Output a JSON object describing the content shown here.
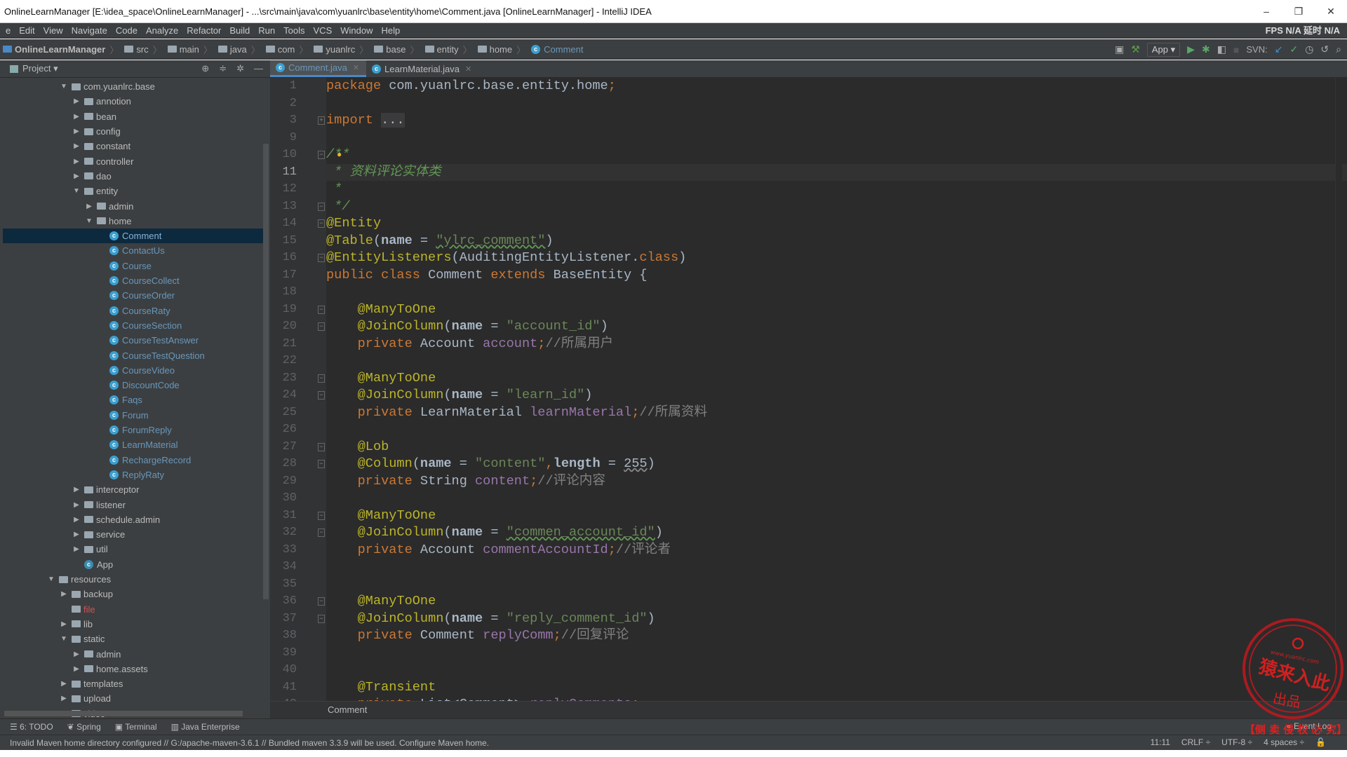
{
  "window": {
    "title": "OnlineLearnManager [E:\\idea_space\\OnlineLearnManager] - ...\\src\\main\\java\\com\\yuanlrc\\base\\entity\\home\\Comment.java [OnlineLearnManager] - IntelliJ IDEA",
    "controls": [
      "–",
      "❐",
      "✕"
    ]
  },
  "menu": [
    "e",
    "Edit",
    "View",
    "Navigate",
    "Code",
    "Analyze",
    "Refactor",
    "Build",
    "Run",
    "Tools",
    "VCS",
    "Window",
    "Help"
  ],
  "fps": "FPS N/A 延时 N/A",
  "breadcrumbs": [
    "OnlineLearnManager",
    "src",
    "main",
    "java",
    "com",
    "yuanlrc",
    "base",
    "entity",
    "home",
    "Comment"
  ],
  "toolbar": {
    "run_config": "App ▾",
    "svn_label": "SVN:"
  },
  "project_panel": {
    "title": "Project ▾"
  },
  "tree": [
    {
      "label": "com.yuanlrc.base",
      "depth": 0,
      "arrow": "down",
      "type": "folder"
    },
    {
      "label": "annotion",
      "depth": 1,
      "arrow": "right",
      "type": "folder"
    },
    {
      "label": "bean",
      "depth": 1,
      "arrow": "right",
      "type": "folder"
    },
    {
      "label": "config",
      "depth": 1,
      "arrow": "right",
      "type": "folder"
    },
    {
      "label": "constant",
      "depth": 1,
      "arrow": "right",
      "type": "folder"
    },
    {
      "label": "controller",
      "depth": 1,
      "arrow": "right",
      "type": "folder"
    },
    {
      "label": "dao",
      "depth": 1,
      "arrow": "right",
      "type": "folder"
    },
    {
      "label": "entity",
      "depth": 1,
      "arrow": "down",
      "type": "folder"
    },
    {
      "label": "admin",
      "depth": 2,
      "arrow": "right",
      "type": "folder"
    },
    {
      "label": "home",
      "depth": 2,
      "arrow": "down",
      "type": "folder"
    },
    {
      "label": "Comment",
      "depth": 3,
      "type": "class",
      "selected": true
    },
    {
      "label": "ContactUs",
      "depth": 3,
      "type": "class"
    },
    {
      "label": "Course",
      "depth": 3,
      "type": "class"
    },
    {
      "label": "CourseCollect",
      "depth": 3,
      "type": "class"
    },
    {
      "label": "CourseOrder",
      "depth": 3,
      "type": "class"
    },
    {
      "label": "CourseRaty",
      "depth": 3,
      "type": "class"
    },
    {
      "label": "CourseSection",
      "depth": 3,
      "type": "class"
    },
    {
      "label": "CourseTestAnswer",
      "depth": 3,
      "type": "class"
    },
    {
      "label": "CourseTestQuestion",
      "depth": 3,
      "type": "class"
    },
    {
      "label": "CourseVideo",
      "depth": 3,
      "type": "class"
    },
    {
      "label": "DiscountCode",
      "depth": 3,
      "type": "class"
    },
    {
      "label": "Faqs",
      "depth": 3,
      "type": "class"
    },
    {
      "label": "Forum",
      "depth": 3,
      "type": "class",
      "status": "red"
    },
    {
      "label": "ForumReply",
      "depth": 3,
      "type": "class",
      "status": "red"
    },
    {
      "label": "LearnMaterial",
      "depth": 3,
      "type": "class"
    },
    {
      "label": "RechargeRecord",
      "depth": 3,
      "type": "class"
    },
    {
      "label": "ReplyRaty",
      "depth": 3,
      "type": "class"
    },
    {
      "label": "interceptor",
      "depth": 1,
      "arrow": "right",
      "type": "folder"
    },
    {
      "label": "listener",
      "depth": 1,
      "arrow": "right",
      "type": "folder"
    },
    {
      "label": "schedule.admin",
      "depth": 1,
      "arrow": "right",
      "type": "folder"
    },
    {
      "label": "service",
      "depth": 1,
      "arrow": "right",
      "type": "folder"
    },
    {
      "label": "util",
      "depth": 1,
      "arrow": "right",
      "type": "folder"
    },
    {
      "label": "App",
      "depth": 1,
      "type": "app"
    },
    {
      "label": "resources",
      "depth": -1,
      "arrow": "down",
      "type": "folder"
    },
    {
      "label": "backup",
      "depth": 0,
      "arrow": "right",
      "type": "folder"
    },
    {
      "label": "file",
      "depth": 0,
      "type": "folder",
      "status": "red"
    },
    {
      "label": "lib",
      "depth": 0,
      "arrow": "right",
      "type": "folder"
    },
    {
      "label": "static",
      "depth": 0,
      "arrow": "down",
      "type": "folder"
    },
    {
      "label": "admin",
      "depth": 1,
      "arrow": "right",
      "type": "folder"
    },
    {
      "label": "home.assets",
      "depth": 1,
      "arrow": "right",
      "type": "folder"
    },
    {
      "label": "templates",
      "depth": 0,
      "arrow": "right",
      "type": "folder"
    },
    {
      "label": "upload",
      "depth": 0,
      "arrow": "right",
      "type": "folder"
    },
    {
      "label": "video",
      "depth": 0,
      "arrow": "right",
      "type": "folder"
    }
  ],
  "tabs": [
    {
      "label": "Comment.java",
      "active": true
    },
    {
      "label": "LearnMaterial.java",
      "active": false
    }
  ],
  "code": [
    {
      "n": "1",
      "t": [
        [
          "kw",
          "package "
        ],
        [
          "id",
          "com.yuanlrc.base.entity.home"
        ],
        [
          "kw",
          ";"
        ]
      ]
    },
    {
      "n": "2",
      "t": []
    },
    {
      "n": "3",
      "fold": "+",
      "t": [
        [
          "kw",
          "import "
        ],
        [
          "fld",
          "..."
        ]
      ]
    },
    {
      "n": "9",
      "t": []
    },
    {
      "n": "10",
      "fold": "-",
      "t": [
        [
          "dc",
          "/**"
        ]
      ]
    },
    {
      "n": "11",
      "cur": true,
      "t": [
        [
          "dc",
          " * 资料评论实体类"
        ]
      ]
    },
    {
      "n": "12",
      "t": [
        [
          "dc",
          " *"
        ]
      ]
    },
    {
      "n": "13",
      "fold": "-",
      "t": [
        [
          "dc",
          " */"
        ]
      ]
    },
    {
      "n": "14",
      "fold": "-",
      "t": [
        [
          "an",
          "@Entity"
        ]
      ]
    },
    {
      "n": "15",
      "t": [
        [
          "an",
          "@Table"
        ],
        [
          "pn",
          "("
        ],
        [
          "nm",
          "name"
        ],
        [
          "pn",
          " = "
        ],
        [
          "st",
          "\"ylrc_comment\""
        ],
        [
          "pn",
          ")"
        ]
      ]
    },
    {
      "n": "16",
      "fold": "-",
      "t": [
        [
          "an",
          "@EntityListeners"
        ],
        [
          "pn",
          "(AuditingEntityListener."
        ],
        [
          "kw",
          "class"
        ],
        [
          "pn",
          ")"
        ]
      ]
    },
    {
      "n": "17",
      "t": [
        [
          "kw",
          "public class "
        ],
        [
          "id",
          "Comment "
        ],
        [
          "kw",
          "extends "
        ],
        [
          "id",
          "BaseEntity {"
        ]
      ]
    },
    {
      "n": "18",
      "t": []
    },
    {
      "n": "19",
      "fold": "-",
      "t": [
        [
          "id",
          "    "
        ],
        [
          "an",
          "@ManyToOne"
        ]
      ]
    },
    {
      "n": "20",
      "fold": "-",
      "t": [
        [
          "id",
          "    "
        ],
        [
          "an",
          "@JoinColumn"
        ],
        [
          "pn",
          "("
        ],
        [
          "nm",
          "name"
        ],
        [
          "pn",
          " = "
        ],
        [
          "st",
          "\"account_id\""
        ],
        [
          "pn",
          ")"
        ]
      ]
    },
    {
      "n": "21",
      "t": [
        [
          "kw",
          "    private "
        ],
        [
          "id",
          "Account "
        ],
        [
          "fd",
          "account"
        ],
        [
          "kw",
          ";"
        ],
        [
          "cm",
          "//所属用户"
        ]
      ]
    },
    {
      "n": "22",
      "t": []
    },
    {
      "n": "23",
      "fold": "-",
      "t": [
        [
          "id",
          "    "
        ],
        [
          "an",
          "@ManyToOne"
        ]
      ]
    },
    {
      "n": "24",
      "fold": "-",
      "t": [
        [
          "id",
          "    "
        ],
        [
          "an",
          "@JoinColumn"
        ],
        [
          "pn",
          "("
        ],
        [
          "nm",
          "name"
        ],
        [
          "pn",
          " = "
        ],
        [
          "st",
          "\"learn_id\""
        ],
        [
          "pn",
          ")"
        ]
      ]
    },
    {
      "n": "25",
      "t": [
        [
          "kw",
          "    private "
        ],
        [
          "id",
          "LearnMaterial "
        ],
        [
          "fd",
          "learnMaterial"
        ],
        [
          "kw",
          ";"
        ],
        [
          "cm",
          "//所属资料"
        ]
      ]
    },
    {
      "n": "26",
      "t": []
    },
    {
      "n": "27",
      "fold": "-",
      "t": [
        [
          "id",
          "    "
        ],
        [
          "an",
          "@Lob"
        ]
      ]
    },
    {
      "n": "28",
      "fold": "-",
      "t": [
        [
          "id",
          "    "
        ],
        [
          "an",
          "@Column"
        ],
        [
          "pn",
          "("
        ],
        [
          "nm",
          "name"
        ],
        [
          "pn",
          " = "
        ],
        [
          "st",
          "\"content\""
        ],
        [
          "kw",
          ","
        ],
        [
          "nm",
          "length"
        ],
        [
          "pn",
          " = "
        ],
        [
          "num",
          "255"
        ],
        [
          "pn",
          ")"
        ]
      ]
    },
    {
      "n": "29",
      "t": [
        [
          "kw",
          "    private "
        ],
        [
          "id",
          "String "
        ],
        [
          "fd",
          "content"
        ],
        [
          "kw",
          ";"
        ],
        [
          "cm",
          "//评论内容"
        ]
      ]
    },
    {
      "n": "30",
      "t": []
    },
    {
      "n": "31",
      "fold": "-",
      "t": [
        [
          "id",
          "    "
        ],
        [
          "an",
          "@ManyToOne"
        ]
      ]
    },
    {
      "n": "32",
      "fold": "-",
      "t": [
        [
          "id",
          "    "
        ],
        [
          "an",
          "@JoinColumn"
        ],
        [
          "pn",
          "("
        ],
        [
          "nm",
          "name"
        ],
        [
          "pn",
          " = "
        ],
        [
          "st",
          "\"commen_account_id\""
        ],
        [
          "pn",
          ")"
        ]
      ]
    },
    {
      "n": "33",
      "t": [
        [
          "kw",
          "    private "
        ],
        [
          "id",
          "Account "
        ],
        [
          "fd",
          "commentAccountId"
        ],
        [
          "kw",
          ";"
        ],
        [
          "cm",
          "//评论者"
        ]
      ]
    },
    {
      "n": "34",
      "t": []
    },
    {
      "n": "35",
      "t": []
    },
    {
      "n": "36",
      "fold": "-",
      "t": [
        [
          "id",
          "    "
        ],
        [
          "an",
          "@ManyToOne"
        ]
      ]
    },
    {
      "n": "37",
      "fold": "-",
      "t": [
        [
          "id",
          "    "
        ],
        [
          "an",
          "@JoinColumn"
        ],
        [
          "pn",
          "("
        ],
        [
          "nm",
          "name"
        ],
        [
          "pn",
          " = "
        ],
        [
          "st",
          "\"reply_comment_id\""
        ],
        [
          "pn",
          ")"
        ]
      ]
    },
    {
      "n": "38",
      "t": [
        [
          "kw",
          "    private "
        ],
        [
          "id",
          "Comment "
        ],
        [
          "fd",
          "replyComm"
        ],
        [
          "kw",
          ";"
        ],
        [
          "cm",
          "//回复评论"
        ]
      ]
    },
    {
      "n": "39",
      "t": []
    },
    {
      "n": "40",
      "t": []
    },
    {
      "n": "41",
      "t": [
        [
          "id",
          "    "
        ],
        [
          "an",
          "@Transient"
        ]
      ]
    },
    {
      "n": "42",
      "t": [
        [
          "kw",
          "    private "
        ],
        [
          "id",
          "List<Comment> "
        ],
        [
          "fd",
          "replyComments"
        ],
        [
          "kw",
          ";"
        ]
      ]
    }
  ],
  "editor_breadcrumb": "Comment",
  "tool_windows": [
    "6: TODO",
    "Spring",
    "Terminal",
    "Java Enterprise"
  ],
  "event_log": "Event Log",
  "status": {
    "message": "Invalid Maven home directory configured // G:/apache-maven-3.6.1 // Bundled maven 3.3.9 will be used.  Configure Maven home.",
    "position": "11:11",
    "line_sep": "CRLF ÷",
    "encoding": "UTF-8 ÷",
    "indent": "4 spaces ÷"
  },
  "watermark": {
    "url": "www.yuanlrc.com",
    "main": "猿来入此",
    "sub": "出品",
    "banner": "【侧 卖 侵 权 必 究】"
  },
  "colors": {
    "keyword": "#cc7832",
    "annotation": "#bbb529",
    "string": "#6a8759",
    "field": "#9876aa",
    "comment": "#808080",
    "doc": "#629755",
    "selection": "#0d293e",
    "accent": "#4a88c7"
  }
}
